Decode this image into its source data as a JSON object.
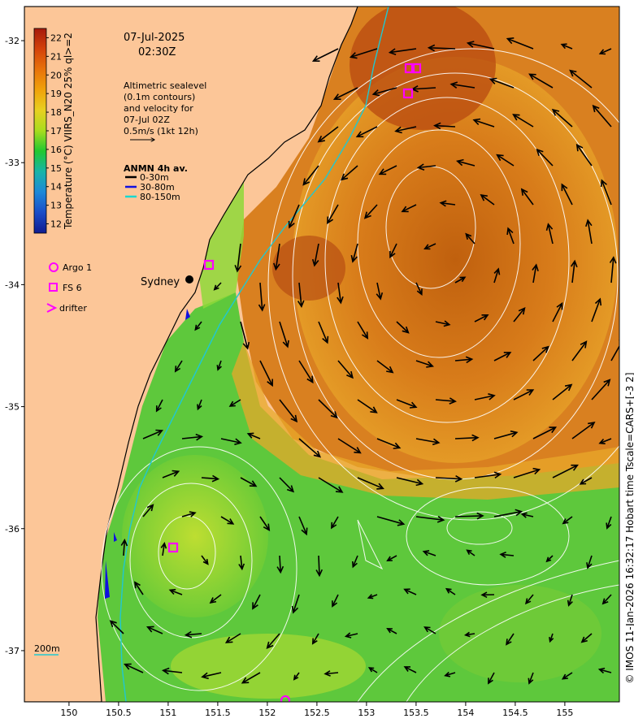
{
  "date": "07-Jul-2025",
  "time": "02:30Z",
  "colorbar": {
    "label": "Temperature (°C) VIIRS_N20 25% ql>=2",
    "ticks": [
      "22",
      "21",
      "20",
      "19",
      "18",
      "17",
      "16",
      "15",
      "14",
      "13",
      "12"
    ],
    "tick_values": [
      22,
      21,
      20,
      19,
      18,
      17,
      16,
      15,
      14,
      13,
      12
    ],
    "stops": [
      "#a51a0c",
      "#d4420a",
      "#e8720a",
      "#f0a20a",
      "#e8d020",
      "#a8dc1e",
      "#20c830",
      "#18b4a8",
      "#1e88d8",
      "#1a4cc8",
      "#101c90"
    ]
  },
  "altimetry_note": [
    "Altimetric sealevel",
    "(0.1m contours)",
    "and velocity for",
    "07-Jul 02Z",
    "0.5m/s (1kt 12h)"
  ],
  "anmn": {
    "title": "ANMN 4h av.",
    "items": [
      {
        "label": "0-30m",
        "color": "#000000"
      },
      {
        "label": "30-80m",
        "color": "#1010e0"
      },
      {
        "label": "80-150m",
        "color": "#18d8d0"
      }
    ]
  },
  "markers_legend": {
    "argo": "Argo 1",
    "fs": "FS 6",
    "drifter": "drifter",
    "color": "#ff00ff"
  },
  "city": "Sydney",
  "depth_label": "200m",
  "x_ticks": [
    "150",
    "150.5",
    "151",
    "151.5",
    "152",
    "152.5",
    "153",
    "153.5",
    "154",
    "154.5",
    "155"
  ],
  "x_tick_values": [
    150,
    150.5,
    151,
    151.5,
    152,
    152.5,
    153,
    153.5,
    154,
    154.5,
    155
  ],
  "y_ticks": [
    "-32",
    "-33",
    "-34",
    "-35",
    "-36",
    "-37"
  ],
  "y_tick_values": [
    -32,
    -33,
    -34,
    -35,
    -36,
    -37
  ],
  "map_extent": {
    "lon": [
      149.55,
      155.55
    ],
    "lat": [
      -31.72,
      -37.42
    ]
  },
  "credit": "© IMOS 11-Jan-2026 16:32:17 Hobart time Tscale=CARS+[-3 2]",
  "colors": {
    "land": "#fcc698",
    "warm": "#d87a1a",
    "cool": "#58c83a"
  }
}
